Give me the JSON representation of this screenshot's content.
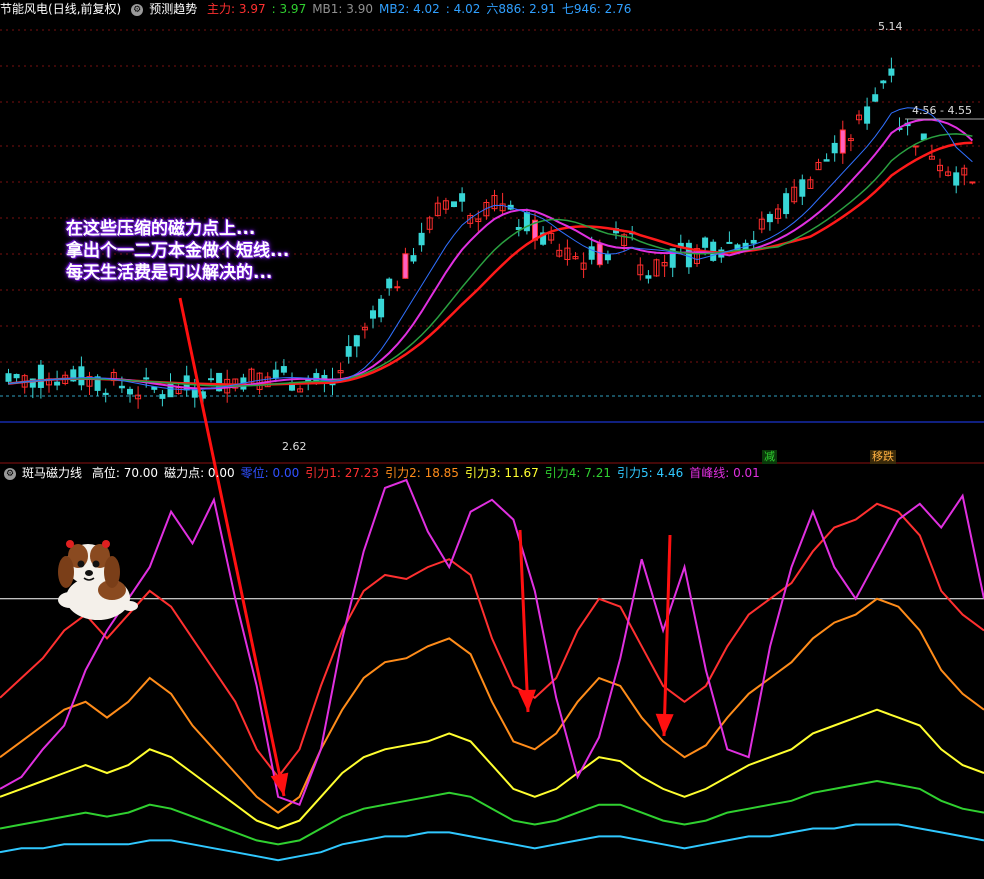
{
  "top_panel": {
    "title": "节能风电",
    "period": "(日线,前复权)",
    "indicator": "预测趋势",
    "values": [
      {
        "text": "主力: 3.97",
        "color": "#ff3030"
      },
      {
        "text": ": 3.97",
        "color": "#30d030"
      },
      {
        "text": "MB1: 3.90",
        "color": "#909090"
      },
      {
        "text": "MB2: 4.02",
        "color": "#30a0ff"
      },
      {
        "text": ": 4.02",
        "color": "#30a0ff"
      },
      {
        "text": "六886: 2.91",
        "color": "#30a0ff"
      },
      {
        "text": "七946: 2.76",
        "color": "#30a0ff"
      }
    ]
  },
  "bottom_panel": {
    "title": "斑马磁力线",
    "values": [
      {
        "text": "高位: 70.00",
        "color": "#ffffff"
      },
      {
        "text": "磁力点: 0.00",
        "color": "#ffffff"
      },
      {
        "text": "零位: 0.00",
        "color": "#3050ff"
      },
      {
        "text": "引力1: 27.23",
        "color": "#ff3030"
      },
      {
        "text": "引力2: 18.85",
        "color": "#ff8c1a"
      },
      {
        "text": "引力3: 11.67",
        "color": "#ffff30"
      },
      {
        "text": "引力4: 7.21",
        "color": "#30d030"
      },
      {
        "text": "引力5: 4.46",
        "color": "#30c8ff"
      },
      {
        "text": "首峰线: 0.01",
        "color": "#e030e0"
      }
    ]
  },
  "annotation": {
    "lines": [
      "在这些压缩的磁力点上...",
      "拿出个一二万本金做个短线...",
      "每天生活费是可以解决的..."
    ]
  },
  "markers": {
    "reduce": "减",
    "stop": "移跌"
  },
  "price_labels": {
    "high": "5.14",
    "mid": "4.56 - 4.55",
    "low": "2.62"
  },
  "chart_data": [
    {
      "type": "candlestick",
      "title": "节能风电 (日线,前复权)",
      "ylim": [
        2.5,
        5.25
      ],
      "high": 5.14,
      "low": 2.62,
      "annotations": [
        "5.14",
        "4.56 - 4.55",
        "2.62"
      ]
    },
    {
      "type": "line",
      "title": "斑马磁力线",
      "ylim": [
        0,
        100
      ],
      "reference_line": 70,
      "series": [
        {
          "name": "首峰线",
          "color": "#e030e0",
          "values": [
            22,
            25,
            32,
            38,
            52,
            62,
            70,
            78,
            92,
            84,
            95,
            70,
            48,
            20,
            18,
            32,
            60,
            82,
            98,
            100,
            87,
            78,
            92,
            95,
            90,
            72,
            45,
            25,
            35,
            55,
            80,
            62,
            78,
            52,
            32,
            30,
            58,
            78,
            92,
            78,
            70,
            80,
            90,
            94,
            88,
            96,
            70
          ]
        },
        {
          "name": "引力1",
          "color": "#ff3030",
          "values": [
            45,
            50,
            55,
            62,
            66,
            60,
            66,
            72,
            68,
            60,
            52,
            44,
            32,
            25,
            32,
            48,
            62,
            72,
            76,
            75,
            78,
            80,
            76,
            60,
            48,
            45,
            50,
            62,
            70,
            68,
            58,
            48,
            44,
            48,
            58,
            66,
            70,
            74,
            82,
            88,
            90,
            94,
            92,
            86,
            72,
            66,
            62
          ]
        },
        {
          "name": "引力2",
          "color": "#ff8c1a",
          "values": [
            30,
            34,
            38,
            42,
            44,
            40,
            44,
            50,
            46,
            38,
            32,
            26,
            20,
            16,
            20,
            32,
            42,
            50,
            54,
            55,
            58,
            60,
            56,
            44,
            34,
            32,
            36,
            44,
            50,
            48,
            40,
            34,
            30,
            33,
            40,
            46,
            50,
            54,
            60,
            64,
            66,
            70,
            68,
            62,
            52,
            46,
            42
          ]
        },
        {
          "name": "引力3",
          "color": "#ffff30",
          "values": [
            20,
            22,
            24,
            26,
            28,
            26,
            28,
            32,
            30,
            26,
            22,
            18,
            14,
            12,
            14,
            20,
            26,
            30,
            32,
            33,
            34,
            36,
            34,
            28,
            22,
            20,
            22,
            26,
            30,
            29,
            25,
            22,
            20,
            22,
            25,
            28,
            30,
            32,
            36,
            38,
            40,
            42,
            40,
            38,
            32,
            28,
            26
          ]
        },
        {
          "name": "引力4",
          "color": "#30d030",
          "values": [
            12,
            13,
            14,
            15,
            16,
            15,
            16,
            18,
            17,
            15,
            13,
            11,
            9,
            8,
            9,
            12,
            15,
            17,
            18,
            19,
            20,
            21,
            20,
            17,
            14,
            13,
            14,
            16,
            18,
            18,
            16,
            14,
            13,
            14,
            16,
            17,
            18,
            19,
            21,
            22,
            23,
            24,
            23,
            22,
            19,
            17,
            16
          ]
        },
        {
          "name": "引力5",
          "color": "#30c8ff",
          "values": [
            6,
            7,
            7,
            8,
            8,
            8,
            8,
            9,
            9,
            8,
            7,
            6,
            5,
            4,
            5,
            6,
            8,
            9,
            10,
            10,
            11,
            11,
            10,
            9,
            8,
            7,
            8,
            9,
            10,
            10,
            9,
            8,
            7,
            8,
            9,
            10,
            10,
            11,
            12,
            12,
            13,
            13,
            13,
            12,
            11,
            10,
            9
          ]
        }
      ]
    }
  ]
}
